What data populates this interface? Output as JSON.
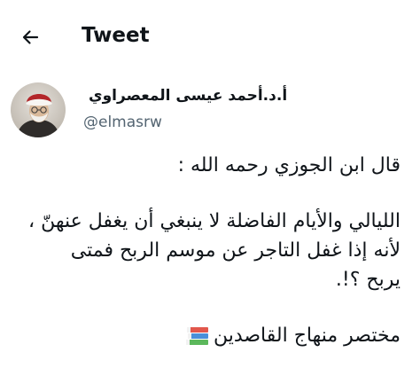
{
  "header": {
    "back_icon": "arrow-left-icon",
    "title": "Tweet"
  },
  "author": {
    "display_name": "أ.د.أحمد عيسى المعصراوي",
    "handle": "@elmasrw",
    "verified_icon": "verified-badge-icon",
    "verified_color": "#1d9bf0"
  },
  "tweet": {
    "line1": "قال ابن الجوزي رحمه الله :",
    "line2": "الليالي والأيام الفاضلة لا ينبغي أن يغفل عنهنّ ،",
    "line3": "لأنه إذا غفل التاجر عن موسم الربح فمتى",
    "line4": "يربح ؟!.",
    "source": "مختصر منهاج القاصدين",
    "source_icon": "books-icon"
  }
}
